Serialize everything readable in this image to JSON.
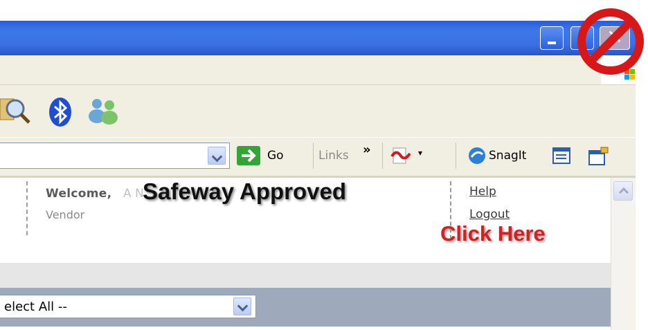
{
  "browser": {
    "window_buttons": {
      "close_glyph": "✕"
    },
    "address_bar": {
      "go_label": "Go",
      "links_label": "Links",
      "links_chevron": "»",
      "pdf_dropdown_glyph": "▾",
      "snagit_label": "SnagIt"
    },
    "toolbar_icons": [
      "magnifier-icon",
      "bluetooth-icon",
      "messenger-icon"
    ]
  },
  "page": {
    "welcome_label": "Welcome,",
    "welcome_name_partial": "A                      N                       5",
    "role": "Vendor",
    "help_link": "Help",
    "logout_link": "Logout",
    "select_value": "elect All --"
  },
  "overlay": {
    "title": "Safeway Approved",
    "click_text": "Click Here"
  },
  "colors": {
    "titlebar": "#3a6fe0",
    "chrome": "#f1efe2",
    "click_here": "#d42020",
    "no_sign": "#d81818"
  }
}
